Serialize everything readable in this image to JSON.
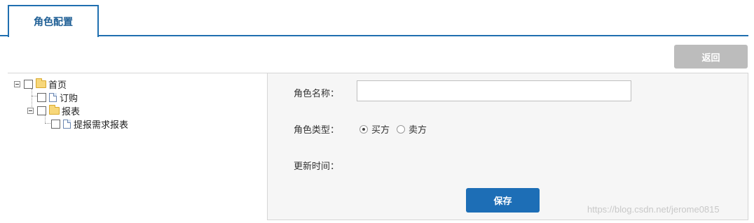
{
  "tabs": [
    {
      "label": "角色配置",
      "active": true
    }
  ],
  "toolbar": {
    "back_label": "返回"
  },
  "tree": {
    "nodes": [
      {
        "label": "首页",
        "type": "folder",
        "expanded": true,
        "checked": false
      },
      {
        "label": "订购",
        "type": "file",
        "checked": false
      },
      {
        "label": "报表",
        "type": "folder",
        "expanded": true,
        "checked": false
      },
      {
        "label": "提报需求报表",
        "type": "file",
        "checked": false
      }
    ]
  },
  "form": {
    "name_label": "角色名称：",
    "name_value": "",
    "type_label": "角色类型：",
    "type_options": [
      {
        "label": "买方",
        "selected": true
      },
      {
        "label": "卖方",
        "selected": false
      }
    ],
    "updated_label": "更新时间：",
    "updated_value": "",
    "save_label": "保存"
  },
  "watermark": "https://blog.csdn.net/jerome0815",
  "colors": {
    "accent": "#1d6eb6",
    "tab_border": "#1f6fb0",
    "disabled_button": "#bcbcbc"
  }
}
